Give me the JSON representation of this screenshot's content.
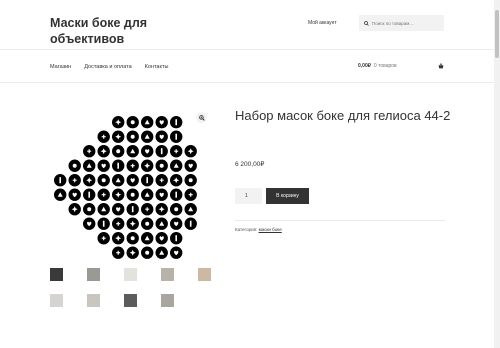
{
  "header": {
    "site_title": "Маски боке для объективов",
    "account_link": "Мой аккаунт",
    "search_placeholder": "Поиск по товарам…"
  },
  "nav": {
    "items": [
      "Магазин",
      "Доставка и оплата",
      "Контакты"
    ]
  },
  "cart": {
    "amount": "0,00₽",
    "count": "0 товаров"
  },
  "product": {
    "title": "Набор масок боке для гелиоса 44-2",
    "price": "6 200,00₽",
    "quantity": "1",
    "add_to_cart": "В корзину",
    "category_label": "Категория:",
    "category_value": "маски боке"
  },
  "icons": {
    "search": "search-icon",
    "cart": "basket-icon",
    "zoom": "magnifier-zoom-icon"
  }
}
